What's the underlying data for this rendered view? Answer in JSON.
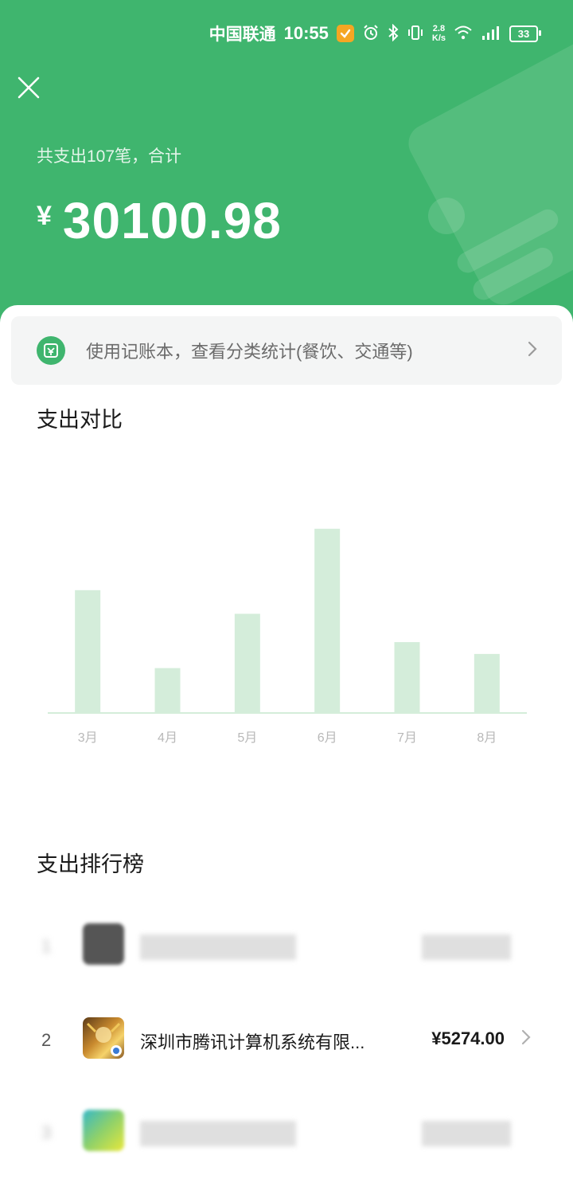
{
  "status_bar": {
    "carrier": "中国联通",
    "time": "10:55",
    "net_speed_value": "2.8",
    "net_speed_unit": "K/s",
    "battery": "33"
  },
  "header": {
    "summary": "共支出107笔，合计",
    "currency_symbol": "¥",
    "total_amount": "30100.98"
  },
  "ledger_banner": {
    "text": "使用记账本，查看分类统计(餐饮、交通等)"
  },
  "comparison": {
    "title": "支出对比",
    "chart_data": {
      "type": "bar",
      "categories": [
        "3月",
        "4月",
        "5月",
        "6月",
        "7月",
        "8月"
      ],
      "values": [
        5200,
        1900,
        4200,
        7800,
        3000,
        2500
      ],
      "ylim": [
        0,
        8500
      ],
      "title": "",
      "xlabel": "",
      "ylabel": "",
      "grid": false,
      "bar_color": "#d4edda",
      "baseline_color": "#d4edda"
    }
  },
  "ranking": {
    "title": "支出排行榜",
    "items": [
      {
        "rank": "1",
        "name": "",
        "amount": ""
      },
      {
        "rank": "2",
        "name": "深圳市腾讯计算机系统有限...",
        "amount": "¥5274.00"
      },
      {
        "rank": "3",
        "name": "",
        "amount": ""
      }
    ]
  },
  "colors": {
    "brand": "#3fb56e",
    "header_bg": "#3fb56e",
    "text_primary": "#1a1a1a",
    "text_secondary": "#6b6b6b"
  },
  "icons": {
    "close": "close-icon",
    "ledger": "ledger-icon",
    "chevron": "chevron-right-icon",
    "alarm": "alarm-icon",
    "bluetooth": "bluetooth-icon",
    "vibrate": "vibrate-icon",
    "wifi": "wifi-icon",
    "signal": "signal-icon",
    "battery": "battery-icon"
  }
}
